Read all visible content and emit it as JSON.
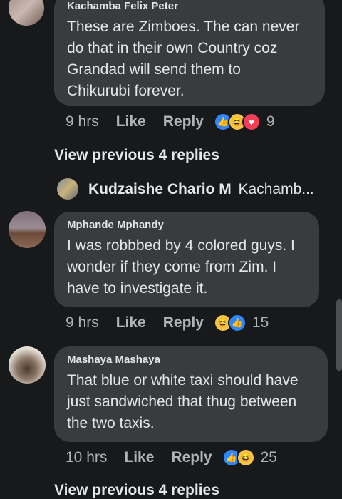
{
  "comments": [
    {
      "author": "Kachamba Felix Peter",
      "text": "These are Zimboes. The can never\ndo that in their own Country coz\nGrandad will  send them to\nChikurubi forever.",
      "time": "9 hrs",
      "like": "Like",
      "reply": "Reply",
      "reactions": [
        "like-icon",
        "haha-icon",
        "love-icon"
      ],
      "reaction_count": "9"
    },
    {
      "author": "Mphande Mphandy",
      "text": "I was robbbed by 4 colored guys. I\nwonder if they come from Zim. I\nhave to investigate it.",
      "time": "9 hrs",
      "like": "Like",
      "reply": "Reply",
      "reactions": [
        "haha-icon",
        "like-icon"
      ],
      "reaction_count": "15"
    },
    {
      "author": "Mashaya Mashaya",
      "text": "That blue or white taxi should have\njust sandwiched that thug between\nthe two taxis.",
      "time": "10 hrs",
      "like": "Like",
      "reply": "Reply",
      "reactions": [
        "like-icon",
        "haha-icon"
      ],
      "reaction_count": "25"
    }
  ],
  "view_previous_1": "View previous 4 replies",
  "reply_preview": {
    "name": "Kudzaishe Chario M",
    "snippet": "Kachamb..."
  },
  "view_previous_2": "View previous 4 replies",
  "colors": {
    "background": "#18191a",
    "bubble": "#3a3b3c",
    "text": "#e4e6eb",
    "muted": "#b0b3b8",
    "like_blue": "#2d88ff",
    "love_red": "#f33e58",
    "haha_yellow": "#f7c44a"
  }
}
